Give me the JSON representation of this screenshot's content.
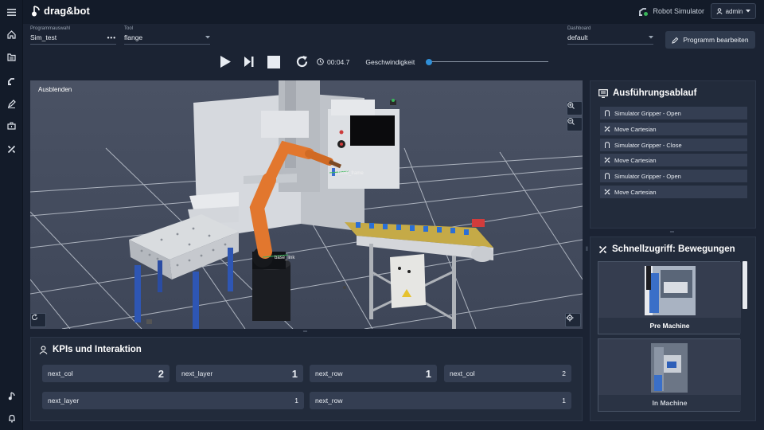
{
  "app": {
    "logo_text": "drag&bot",
    "simulator_label": "Robot Simulator",
    "user_label": "admin"
  },
  "sidebar": {
    "items": [
      {
        "icon": "menu-icon"
      },
      {
        "icon": "home-icon"
      },
      {
        "icon": "folder-icon"
      },
      {
        "icon": "robot-arm-icon"
      },
      {
        "icon": "edit-icon"
      },
      {
        "icon": "toolbox-icon"
      },
      {
        "icon": "tools-icon"
      },
      {
        "icon": "music-note-icon"
      },
      {
        "icon": "bell-icon"
      }
    ]
  },
  "toolbar": {
    "program_label": "Programmauswahl",
    "program_value": "Sim_test",
    "tool_label": "Tool",
    "tool_value": "flange",
    "dashboard_label": "Dashboard",
    "dashboard_value": "default",
    "edit_button": "Programm bearbeiten"
  },
  "playback": {
    "time": "00:04.7",
    "speed_label": "Geschwindigkeit",
    "speed_fraction": 0.0
  },
  "viewer": {
    "hide_label": "Ausblenden",
    "frame_labels": [
      "tool0_frame",
      "base_link"
    ]
  },
  "execution": {
    "title": "Ausführungsablauf",
    "items": [
      {
        "label": "Simulator Gripper - Open",
        "icon": "gripper-icon"
      },
      {
        "label": "Move Cartesian",
        "icon": "move-icon"
      },
      {
        "label": "Simulator Gripper - Close",
        "icon": "gripper-icon"
      },
      {
        "label": "Move Cartesian",
        "icon": "move-icon"
      },
      {
        "label": "Simulator Gripper - Open",
        "icon": "gripper-icon"
      },
      {
        "label": "Move Cartesian",
        "icon": "move-icon"
      }
    ]
  },
  "kpis": {
    "title": "KPIs und Interaktion",
    "row1": [
      {
        "name": "next_col",
        "value": "2"
      },
      {
        "name": "next_layer",
        "value": "1"
      },
      {
        "name": "next_row",
        "value": "1"
      },
      {
        "name": "next_col",
        "value": "2"
      }
    ],
    "row2": [
      {
        "name": "next_layer",
        "value": "1"
      },
      {
        "name": "next_row",
        "value": "1"
      }
    ]
  },
  "quick": {
    "title": "Schnellzugriff: Bewegungen",
    "cards": [
      {
        "label": "Pre Machine"
      },
      {
        "label": "In Machine"
      }
    ]
  },
  "colors": {
    "accent": "#2f8fd8",
    "robot_orange": "#e2772e",
    "background": "#1b2333"
  }
}
